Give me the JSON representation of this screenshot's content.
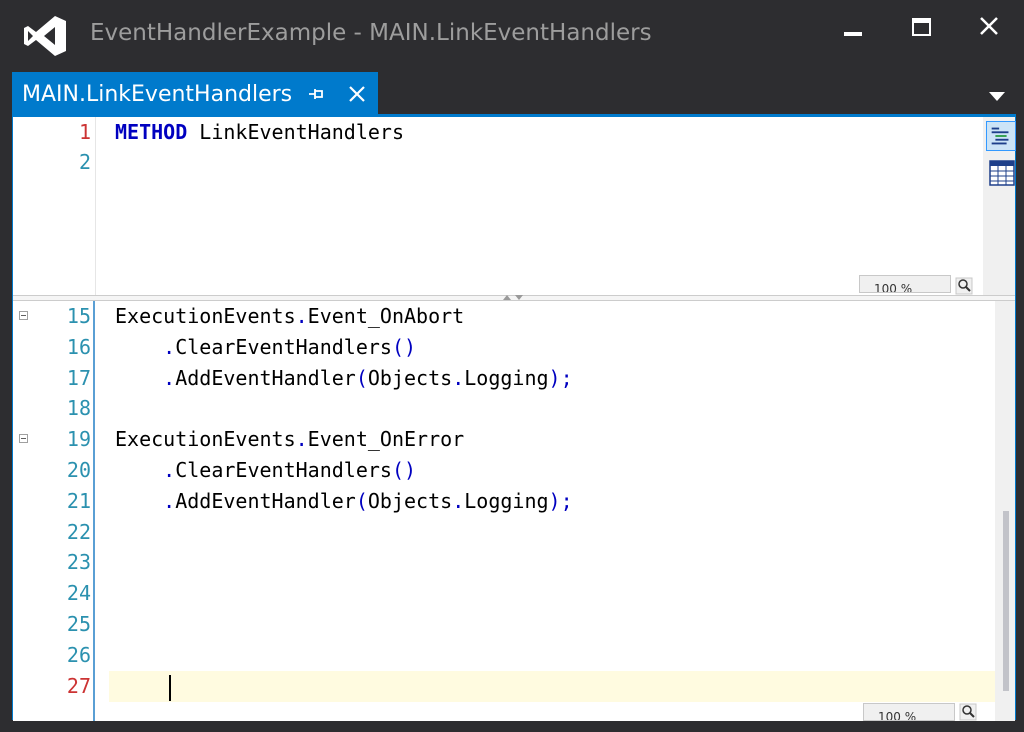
{
  "window": {
    "title": "EventHandlerExample - MAIN.LinkEventHandlers",
    "minimize": "minimize",
    "maximize": "maximize",
    "close": "close"
  },
  "tab": {
    "label": "MAIN.LinkEventHandlers",
    "pin_icon": "pin-icon",
    "close_icon": "close-icon"
  },
  "upper_editor": {
    "lines": [
      {
        "num": "1",
        "keyword": "METHOD",
        "text": " LinkEventHandlers"
      },
      {
        "num": "2",
        "keyword": "",
        "text": ""
      }
    ],
    "zoom": "100 %"
  },
  "lower_editor": {
    "lines": [
      {
        "num": "15",
        "fold": true,
        "parts": [
          {
            "t": "ExecutionEvents",
            "c": "n"
          },
          {
            "t": ".",
            "c": "d"
          },
          {
            "t": "Event_OnAbort",
            "c": "n"
          }
        ]
      },
      {
        "num": "16",
        "fold": false,
        "parts": [
          {
            "t": "    ",
            "c": "n"
          },
          {
            "t": ".",
            "c": "d"
          },
          {
            "t": "ClearEventHandlers",
            "c": "n"
          },
          {
            "t": "()",
            "c": "p"
          }
        ]
      },
      {
        "num": "17",
        "fold": false,
        "parts": [
          {
            "t": "    ",
            "c": "n"
          },
          {
            "t": ".",
            "c": "d"
          },
          {
            "t": "AddEventHandler",
            "c": "n"
          },
          {
            "t": "(",
            "c": "p"
          },
          {
            "t": "Objects",
            "c": "n"
          },
          {
            "t": ".",
            "c": "d"
          },
          {
            "t": "Logging",
            "c": "n"
          },
          {
            "t": ");",
            "c": "p"
          }
        ]
      },
      {
        "num": "18",
        "fold": false,
        "parts": []
      },
      {
        "num": "19",
        "fold": true,
        "parts": [
          {
            "t": "ExecutionEvents",
            "c": "n"
          },
          {
            "t": ".",
            "c": "d"
          },
          {
            "t": "Event_OnError",
            "c": "n"
          }
        ]
      },
      {
        "num": "20",
        "fold": false,
        "parts": [
          {
            "t": "    ",
            "c": "n"
          },
          {
            "t": ".",
            "c": "d"
          },
          {
            "t": "ClearEventHandlers",
            "c": "n"
          },
          {
            "t": "()",
            "c": "p"
          }
        ]
      },
      {
        "num": "21",
        "fold": false,
        "parts": [
          {
            "t": "    ",
            "c": "n"
          },
          {
            "t": ".",
            "c": "d"
          },
          {
            "t": "AddEventHandler",
            "c": "n"
          },
          {
            "t": "(",
            "c": "p"
          },
          {
            "t": "Objects",
            "c": "n"
          },
          {
            "t": ".",
            "c": "d"
          },
          {
            "t": "Logging",
            "c": "n"
          },
          {
            "t": ");",
            "c": "p"
          }
        ]
      },
      {
        "num": "22",
        "fold": false,
        "parts": []
      },
      {
        "num": "23",
        "fold": false,
        "parts": []
      },
      {
        "num": "24",
        "fold": false,
        "parts": []
      },
      {
        "num": "25",
        "fold": false,
        "parts": []
      },
      {
        "num": "26",
        "fold": false,
        "parts": []
      },
      {
        "num": "27",
        "fold": false,
        "parts": [],
        "current": true
      }
    ],
    "zoom": "100 %"
  },
  "colors": {
    "accent": "#007acc",
    "keyword": "#0000c0",
    "line_number": "#2b91af",
    "current_line_number": "#cc3333",
    "title_bar": "#2d2d30"
  },
  "icons": [
    "visual-studio-logo-icon",
    "pin-icon",
    "close-icon",
    "chevron-down-icon",
    "text-view-icon",
    "table-view-icon",
    "zoom-magnifier-icon"
  ]
}
